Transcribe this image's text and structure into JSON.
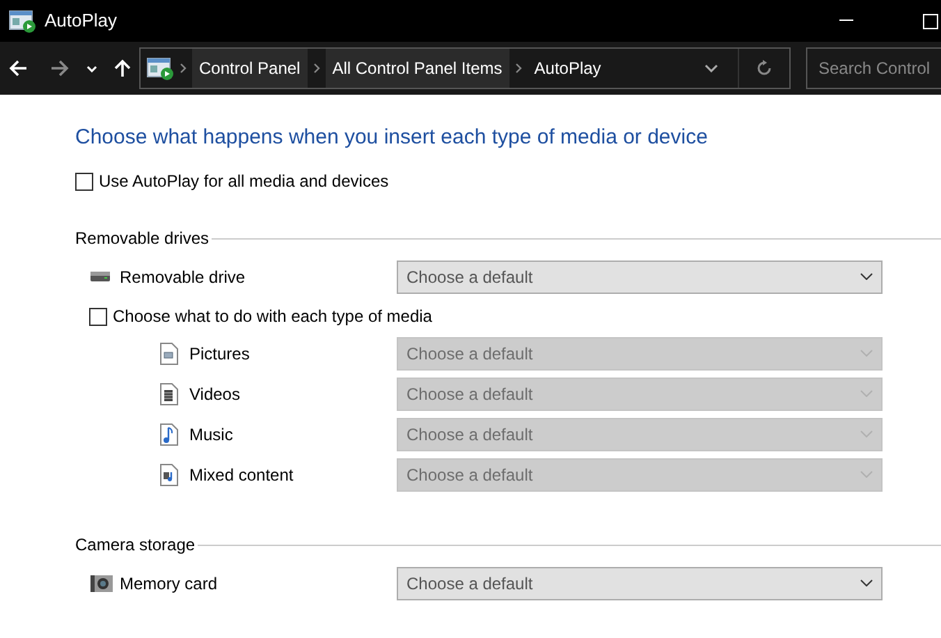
{
  "window": {
    "title": "AutoPlay"
  },
  "nav": {
    "breadcrumbs": [
      {
        "label": "Control Panel"
      },
      {
        "label": "All Control Panel Items"
      },
      {
        "label": "AutoPlay"
      }
    ],
    "search": {
      "placeholder": "Search Control"
    }
  },
  "heading": "Choose what happens when you insert each type of media or device",
  "use_autoplay": {
    "label": "Use AutoPlay for all media and devices",
    "checked": false
  },
  "sections": [
    {
      "title": "Removable drives",
      "rows": [
        {
          "kind": "device",
          "label": "Removable drive",
          "dropdown": {
            "value": "Choose a default",
            "disabled": false
          }
        },
        {
          "kind": "checkbox",
          "label": "Choose what to do with each type of media",
          "checked": false
        },
        {
          "kind": "media",
          "label": "Pictures",
          "dropdown": {
            "value": "Choose a default",
            "disabled": true
          }
        },
        {
          "kind": "media",
          "label": "Videos",
          "dropdown": {
            "value": "Choose a default",
            "disabled": true
          }
        },
        {
          "kind": "media",
          "label": "Music",
          "dropdown": {
            "value": "Choose a default",
            "disabled": true
          }
        },
        {
          "kind": "media",
          "label": "Mixed content",
          "dropdown": {
            "value": "Choose a default",
            "disabled": true
          }
        }
      ]
    },
    {
      "title": "Camera storage",
      "rows": [
        {
          "kind": "device",
          "label": "Memory card",
          "dropdown": {
            "value": "Choose a default",
            "disabled": false
          }
        }
      ]
    }
  ]
}
